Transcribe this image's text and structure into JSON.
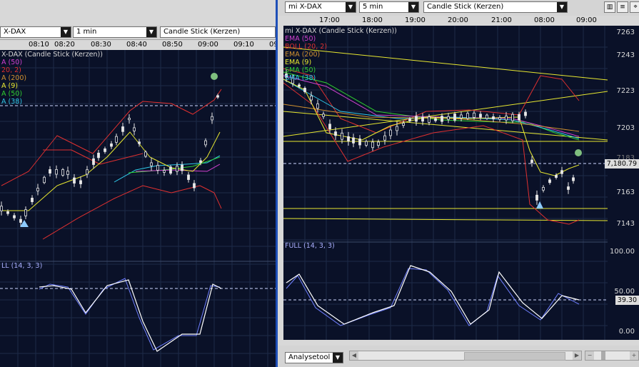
{
  "left_window": {
    "symbol": "X-DAX",
    "interval": "1 min",
    "chart_type": "Candle Stick (Kerzen)",
    "time_ticks": [
      "08:10",
      "08:20",
      "08:30",
      "08:40",
      "08:50",
      "09:00",
      "09:10",
      "09:"
    ],
    "legend_title": "X-DAX (Candle Stick (Kerzen))",
    "legend": [
      {
        "text": "A (50)",
        "color": "#d040d0"
      },
      {
        "text": "20, 2)",
        "color": "#e03030"
      },
      {
        "text": "A (200)",
        "color": "#d09030"
      },
      {
        "text": "A (9)",
        "color": "#e8e830"
      },
      {
        "text": "A (50)",
        "color": "#30d030"
      },
      {
        "text": "A (38)",
        "color": "#30c8e8"
      }
    ],
    "indicator_label": "LL (14, 3, 3)"
  },
  "right_window": {
    "symbol": "mi X-DAX",
    "interval": "5 min",
    "chart_type": "Candle Stick (Kerzen)",
    "time_ticks": [
      "17:00",
      "18:00",
      "19:00",
      "20:00",
      "21:00",
      "08:00",
      "09:00"
    ],
    "legend_title": "mi X-DAX (Candle Stick (Kerzen))",
    "legend": [
      {
        "text": "EMA (50)",
        "color": "#d040d0"
      },
      {
        "text": "BOLL (20, 2)",
        "color": "#e03030"
      },
      {
        "text": "EMA (200)",
        "color": "#d09030"
      },
      {
        "text": "EMA (9)",
        "color": "#e8e830"
      },
      {
        "text": "SMA (50)",
        "color": "#30d030"
      },
      {
        "text": "SMA (38)",
        "color": "#30c8e8"
      }
    ],
    "price_ticks": [
      "7263",
      "7243",
      "7223",
      "7203",
      "7183",
      "7163",
      "7143"
    ],
    "current_price": "7,180.79",
    "indicator_label": "FULL (14, 3, 3)",
    "osc_ticks": [
      "100.00",
      "50.00",
      "0.00"
    ],
    "osc_value": "39.30",
    "analysis_tool": "Analysetool"
  },
  "colors": {
    "background": "#0a1128",
    "grid": "#1d2a48",
    "candle": "#e8e8e8",
    "stoch": "#ffffff",
    "signal": "#6f7fff"
  }
}
